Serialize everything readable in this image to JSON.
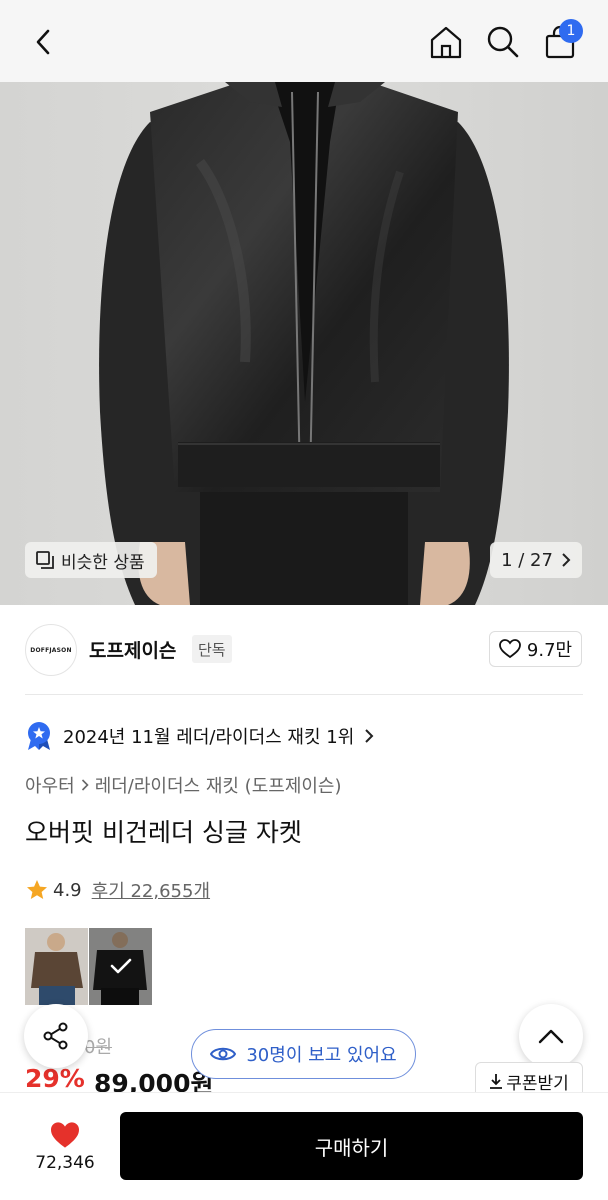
{
  "header": {
    "back_icon": "chevron-left-icon",
    "home_icon": "home-icon",
    "search_icon": "search-icon",
    "cart_icon": "shopping-bag-icon",
    "cart_badge": "1"
  },
  "gallery": {
    "similar_label": "비슷한 상품",
    "pager": "1 / 27"
  },
  "brand": {
    "logo_text": "DOFFJASON",
    "name": "도프제이슨",
    "tag": "단독",
    "likes": "9.7만"
  },
  "ranking": {
    "text": "2024년 11월 레더/라이더스 재킷 1위"
  },
  "breadcrumb": {
    "category": "아우터",
    "subcategory": "레더/라이더스 재킷 (도프제이슨)"
  },
  "product": {
    "title": "오버핏 비건레더 싱글 자켓",
    "rating": "4.9",
    "reviews": "후기 22,655개",
    "original_price": "0원",
    "discount": "29%",
    "price": "89,000원"
  },
  "floating": {
    "viewers": "30명이 보고 있어요",
    "coupon": "쿠폰받기"
  },
  "bottom": {
    "wish_count": "72,346",
    "buy_label": "구매하기"
  },
  "colors": {
    "accent_blue": "#2f6bf0",
    "discount_red": "#e5312b",
    "heart_red": "#e5312b"
  }
}
